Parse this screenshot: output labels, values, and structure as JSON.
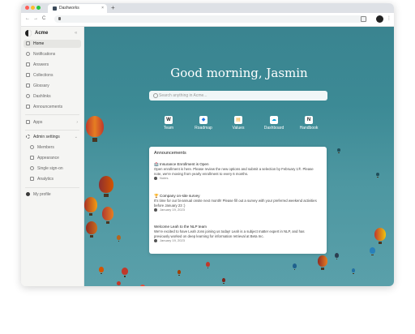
{
  "browser": {
    "tab_title": "Dashworks",
    "tab_close": "×",
    "new_tab": "+",
    "back": "←",
    "forward": "→",
    "reload": "C",
    "menu": "⋮",
    "dots": [
      "#ff5f57",
      "#febc2e",
      "#28c840"
    ]
  },
  "sidebar": {
    "brand": "Acme",
    "collapse": "«",
    "items": [
      {
        "label": "Home",
        "icon": "home-icon",
        "active": true
      },
      {
        "label": "Notifications",
        "icon": "bell-icon"
      },
      {
        "label": "Answers",
        "icon": "answers-icon"
      },
      {
        "label": "Collections",
        "icon": "collections-icon"
      },
      {
        "label": "Glossary",
        "icon": "glossary-icon"
      },
      {
        "label": "Dashlinks",
        "icon": "link-icon"
      },
      {
        "label": "Announcements",
        "icon": "megaphone-icon"
      }
    ],
    "apps": {
      "label": "Apps",
      "chevron": "›"
    },
    "admin": {
      "label": "Admin settings",
      "chevron": "⌄",
      "items": [
        {
          "label": "Members",
          "icon": "members-icon"
        },
        {
          "label": "Appearance",
          "icon": "appearance-icon"
        },
        {
          "label": "Single sign-on",
          "icon": "key-icon"
        },
        {
          "label": "Analytics",
          "icon": "analytics-icon"
        }
      ]
    },
    "profile": {
      "label": "My profile",
      "icon": "profile-avatar-icon"
    }
  },
  "main": {
    "greeting": "Good morning, Jasmin",
    "search_placeholder": "Search anything in Acme...",
    "shortcuts": [
      {
        "label": "Team",
        "glyph": "W",
        "color": "#222222"
      },
      {
        "label": "Roadmap",
        "glyph": "◆",
        "color": "#1a73e8"
      },
      {
        "label": "Values",
        "glyph": "▤",
        "color": "#f5a623"
      },
      {
        "label": "Dashboard",
        "glyph": "☁",
        "color": "#00a1e0"
      },
      {
        "label": "Handbook",
        "glyph": "N",
        "color": "#222222"
      }
    ],
    "announcements": {
      "title": "Announcements",
      "items": [
        {
          "title": "🏥 Insurance Enrollment is Open",
          "body": "Open enrollment is here. Please review the new options and submit a selection by February 1®. Please note, we're moving from yearly enrollment to every 6 months.",
          "meta": "Notes"
        },
        {
          "title": "🏆 Company on-site survey",
          "body": "It's time for our bi-annual onsite next month! Please fill out a survey with your preferred weekend activities before January 23 :)",
          "meta": "January 19, 2023"
        },
        {
          "title": "Welcome Leah to the NLP team",
          "body": "We're excited to have Leah Jons joining us today! Leah is a subject matter expert in NLP, and has previously worked on deep learning for information retrieval at Beta Inc.",
          "meta": "January 19, 2023"
        }
      ]
    }
  }
}
